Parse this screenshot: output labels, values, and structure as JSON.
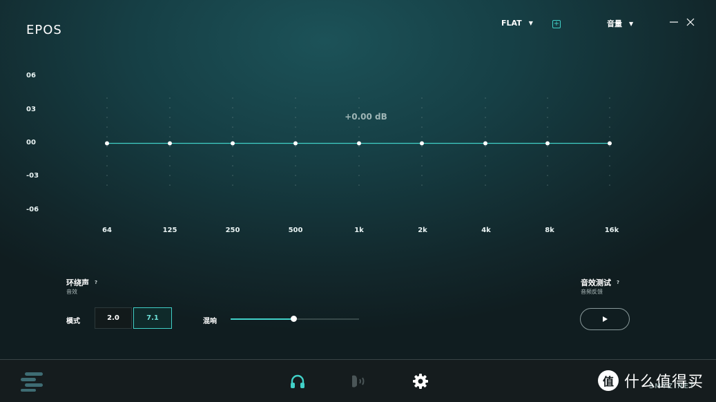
{
  "header": {
    "logo": "EPOS",
    "preset": "FLAT",
    "volume_label": "音量"
  },
  "eq": {
    "y_labels": [
      "06",
      "03",
      "00",
      "-03",
      "-06"
    ],
    "x_labels": [
      "64",
      "125",
      "250",
      "500",
      "1k",
      "2k",
      "4k",
      "8k",
      "16k"
    ],
    "readout": "+0.00 dB"
  },
  "chart_data": {
    "type": "line",
    "categories": [
      "64",
      "125",
      "250",
      "500",
      "1k",
      "2k",
      "4k",
      "8k",
      "16k"
    ],
    "series": [
      {
        "values": [
          0,
          0,
          0,
          0,
          0,
          0,
          0,
          0,
          0
        ]
      }
    ],
    "ylim": [
      -6,
      6
    ],
    "y_ticks": [
      "06",
      "03",
      "00",
      "-03",
      "-06"
    ]
  },
  "surround": {
    "title": "环绕声",
    "subtitle": "音效",
    "help": "?",
    "mode_label": "模式",
    "mode_options": [
      "2.0",
      "7.1"
    ],
    "selected_mode": "7.1",
    "reverb_label": "混响",
    "reverb_value": 0.49
  },
  "sound_test": {
    "title": "音效测试",
    "subtitle": "音频反馈",
    "help": "?"
  },
  "bottom_nav": {
    "items": [
      "menu-icon",
      "headphones-icon",
      "microphone-icon",
      "gear-icon"
    ],
    "active": "headphones-icon",
    "accent": "#41d1c8"
  },
  "watermark": {
    "glyph": "值",
    "text": "什么值得买",
    "sub": "SMYZ.NET"
  },
  "colors": {
    "accent": "#41d1c8"
  }
}
